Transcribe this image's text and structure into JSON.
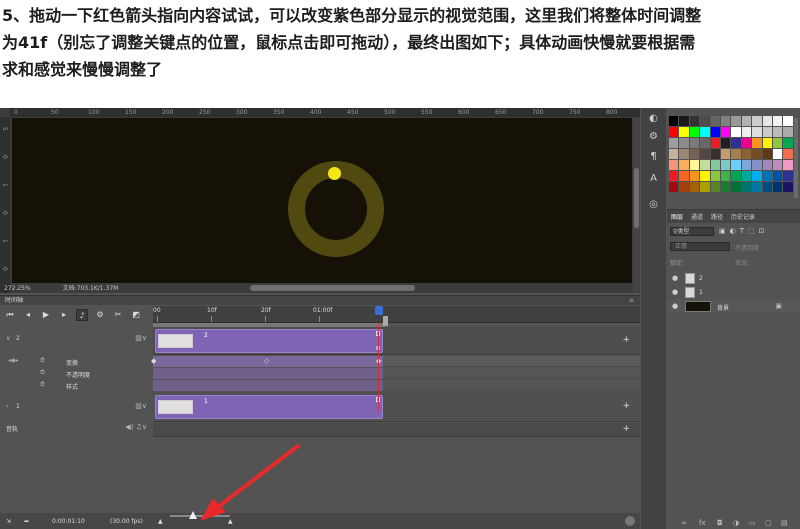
{
  "article": {
    "line1": "5、拖动一下红色箭头指向内容试试，可以改变紫色部分显示的视觉范围，这里我们将整体时间调整",
    "line2": "为41f（别忘了调整关键点的位置，鼠标点击即可拖动），最终出图如下；具体动画快慢就要根据需",
    "line3": "求和感觉来慢慢调整了"
  },
  "canvas": {
    "ruler_top": [
      "0",
      "50",
      "100",
      "150",
      "200",
      "250",
      "300",
      "350",
      "400",
      "450",
      "500",
      "550",
      "600",
      "650",
      "700",
      "750",
      "800",
      "850"
    ],
    "ruler_left": [
      "5",
      "0",
      "1",
      "0",
      "1",
      "0"
    ],
    "zoom": "272.25%",
    "doc_info": "文档:703.1K/1.37M",
    "doc_bg": "#151106",
    "ring_color": "#514a10",
    "dot_color": "#f4e814"
  },
  "swatches": {
    "colors": [
      "#000000",
      "#1a1a1a",
      "#333333",
      "#4d4d4d",
      "#666666",
      "#808080",
      "#999999",
      "#b3b3b3",
      "#cccccc",
      "#e6e6e6",
      "#f2f2f2",
      "#ffffff",
      "#ff0000",
      "#ffff00",
      "#00ff00",
      "#00ffff",
      "#0000ff",
      "#ff00ff",
      "#ffffff",
      "#eeeeee",
      "#dddddd",
      "#cccccc",
      "#bbbbbb",
      "#aaaaaa",
      "#9e9e9e",
      "#8c8c8c",
      "#7a7a7a",
      "#686868",
      "#ed1c24",
      "#231f20",
      "#2e3192",
      "#ec008c",
      "#f7941d",
      "#fff200",
      "#8dc63f",
      "#00a651",
      "#c7b299",
      "#998675",
      "#736357",
      "#534741",
      "#362f2d",
      "#c69c6d",
      "#a67c52",
      "#8c6239",
      "#754c24",
      "#603913",
      "#ffffff",
      "#f26c4f",
      "#f69679",
      "#fbaf5d",
      "#fff799",
      "#c4df9b",
      "#82ca9d",
      "#7accc8",
      "#6dcff6",
      "#7ea7d8",
      "#8393ca",
      "#a187be",
      "#bc8cbf",
      "#f49ac2",
      "#ed1c24",
      "#f26522",
      "#f7941d",
      "#fff200",
      "#8dc63f",
      "#39b54a",
      "#00a651",
      "#00a99d",
      "#00aeef",
      "#0072bc",
      "#0054a6",
      "#2e3192",
      "#9e0b0f",
      "#a0410d",
      "#a36209",
      "#aba000",
      "#598527",
      "#197b30",
      "#007236",
      "#00746b",
      "#0076a3",
      "#004b80",
      "#003471",
      "#1b1464"
    ]
  },
  "layers_panel": {
    "tabs": [
      "图层",
      "通道",
      "路径",
      "历史记录"
    ],
    "filter_label": "♀类型",
    "mode": "正常",
    "opacity_label": "不透明度：",
    "lock_label": "锁定：",
    "fill_label": "填充：",
    "layers": [
      {
        "name": "2"
      },
      {
        "name": "1"
      },
      {
        "name": "背景"
      }
    ]
  },
  "timeline": {
    "title": "时间轴",
    "ruler": [
      "00",
      "10f",
      "20f",
      "01:00f"
    ],
    "tracks": [
      {
        "name": "2",
        "clip": "2"
      },
      {
        "name": "1",
        "clip": "1"
      }
    ],
    "sub_rows": [
      "变换",
      "不透明度",
      "样式"
    ],
    "audio_label": "音轨",
    "timecode": "0:00:01:10",
    "fps": "(30.00 fps)"
  }
}
